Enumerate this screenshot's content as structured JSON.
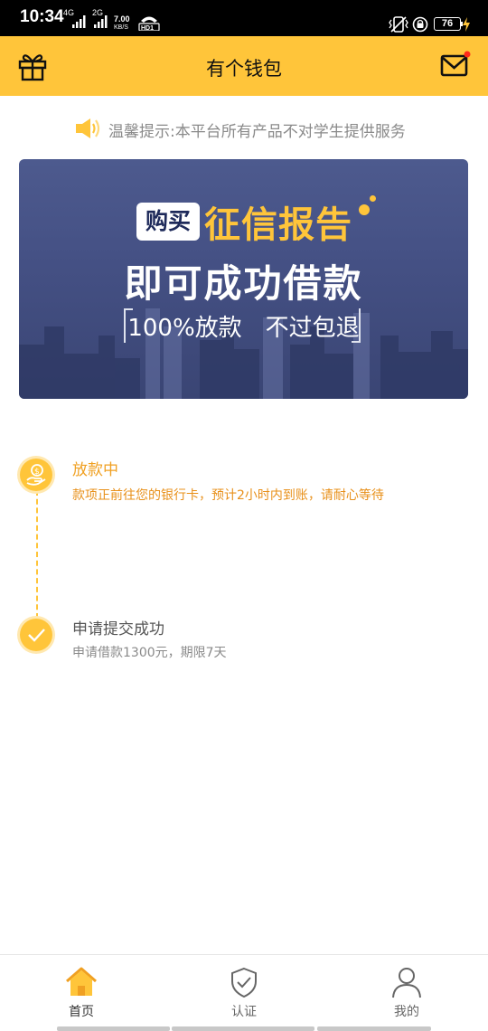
{
  "status_bar": {
    "time": "10:34",
    "signal1": "4G",
    "signal2": "2G",
    "speed": "7.00",
    "speed_unit": "KB/S",
    "battery": "76"
  },
  "header": {
    "title": "有个钱包",
    "has_unread": true,
    "accent_color": "#ffc53a"
  },
  "notice": {
    "text": "温馨提示:本平台所有产品不对学生提供服务"
  },
  "banner": {
    "tag": "购买",
    "headline": "征信报告",
    "main": "即可成功借款",
    "sub": "100%放款　不过包退"
  },
  "timeline": {
    "steps": [
      {
        "title": "放款中",
        "desc": "款项正前往您的银行卡，预计2小时内到账，请耐心等待",
        "icon": "coin-hand-icon"
      },
      {
        "title": "申请提交成功",
        "desc": "申请借款1300元，期限7天",
        "icon": "check-icon"
      }
    ]
  },
  "bottom_nav": {
    "items": [
      {
        "label": "首页",
        "icon": "home-icon",
        "active": true
      },
      {
        "label": "认证",
        "icon": "shield-check-icon",
        "active": false
      },
      {
        "label": "我的",
        "icon": "user-icon",
        "active": false
      }
    ]
  }
}
